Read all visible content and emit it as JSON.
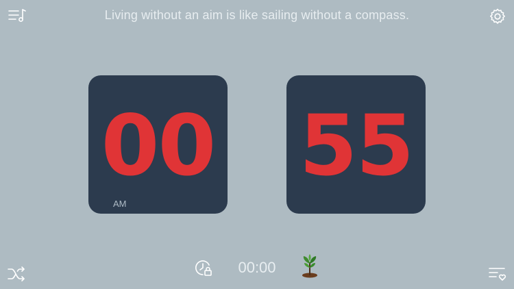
{
  "quote": "Living without an aim is like sailing without a compass.",
  "clock": {
    "hours": "00",
    "minutes": "55",
    "period": "AM"
  },
  "timer": {
    "display": "00:00"
  },
  "icons": {
    "top_left": "playlist-music-icon",
    "top_right": "gear-icon",
    "bottom_left": "shuffle-icon",
    "timer": "clock-lock-icon",
    "plant": "sprout-icon",
    "bottom_right": "favorites-list-icon"
  },
  "colors": {
    "background": "#aebbc2",
    "card": "#2c3b4e",
    "digits": "#e03436"
  }
}
